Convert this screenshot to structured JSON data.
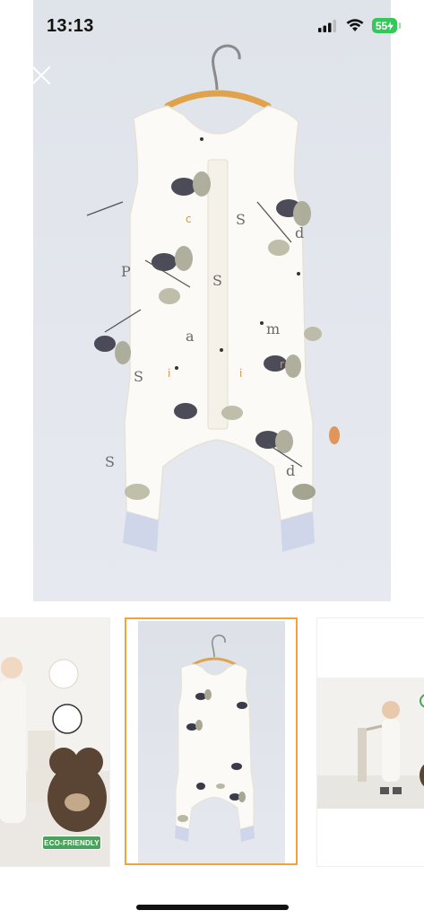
{
  "status_bar": {
    "time": "13:13",
    "battery": "55"
  },
  "gallery": {
    "close_icon": "close-icon",
    "selected_index": 1,
    "accent_color": "#f2a33a",
    "thumbnails": [
      {
        "badge": "ECO-FRIENDLY"
      },
      {
        "badge": ""
      },
      {
        "badge": ""
      }
    ]
  }
}
